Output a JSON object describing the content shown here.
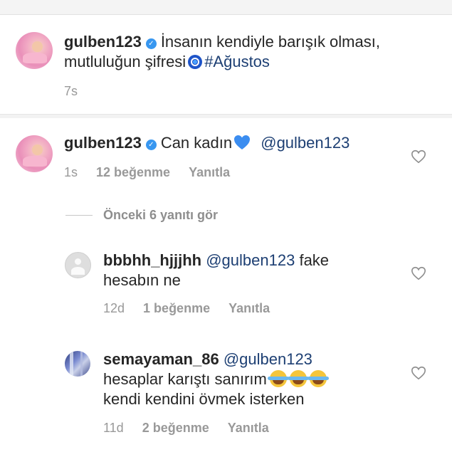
{
  "post": {
    "username": "gulben123",
    "caption_line1": "İnsanın kendiyle barışık olması,",
    "caption_line2": "mutluluğun şifresi",
    "hashtag": "#Ağustos",
    "time": "7s"
  },
  "comments": [
    {
      "username": "gulben123",
      "text": "Can kadın",
      "mention": "@gulben123",
      "time": "1s",
      "likes": "12 beğenme",
      "reply": "Yanıtla"
    }
  ],
  "view_replies": "Önceki 6 yanıtı gör",
  "replies": [
    {
      "username": "bbbhh_hjjjhh",
      "mention": "@gulben123",
      "text_line1": "fake",
      "text_line2": "hesabın ne",
      "time": "12d",
      "likes": "1 beğenme",
      "reply": "Yanıtla"
    },
    {
      "username": "semayaman_86",
      "mention": "@gulben123",
      "text_line1": "hesaplar karıştı sanırım",
      "text_line2": "kendi kendini övmek isterken",
      "time": "11d",
      "likes": "2 beğenme",
      "reply": "Yanıtla"
    }
  ],
  "icons": {
    "verified": "verified-badge-icon",
    "like": "heart-outline-icon",
    "evil_eye": "nazar-emoji",
    "blue_heart": "blue-heart-emoji",
    "laugh": "tears-of-joy-emoji"
  },
  "colors": {
    "verified": "#3897f0",
    "mention": "#1d3f73",
    "meta": "#999999"
  }
}
